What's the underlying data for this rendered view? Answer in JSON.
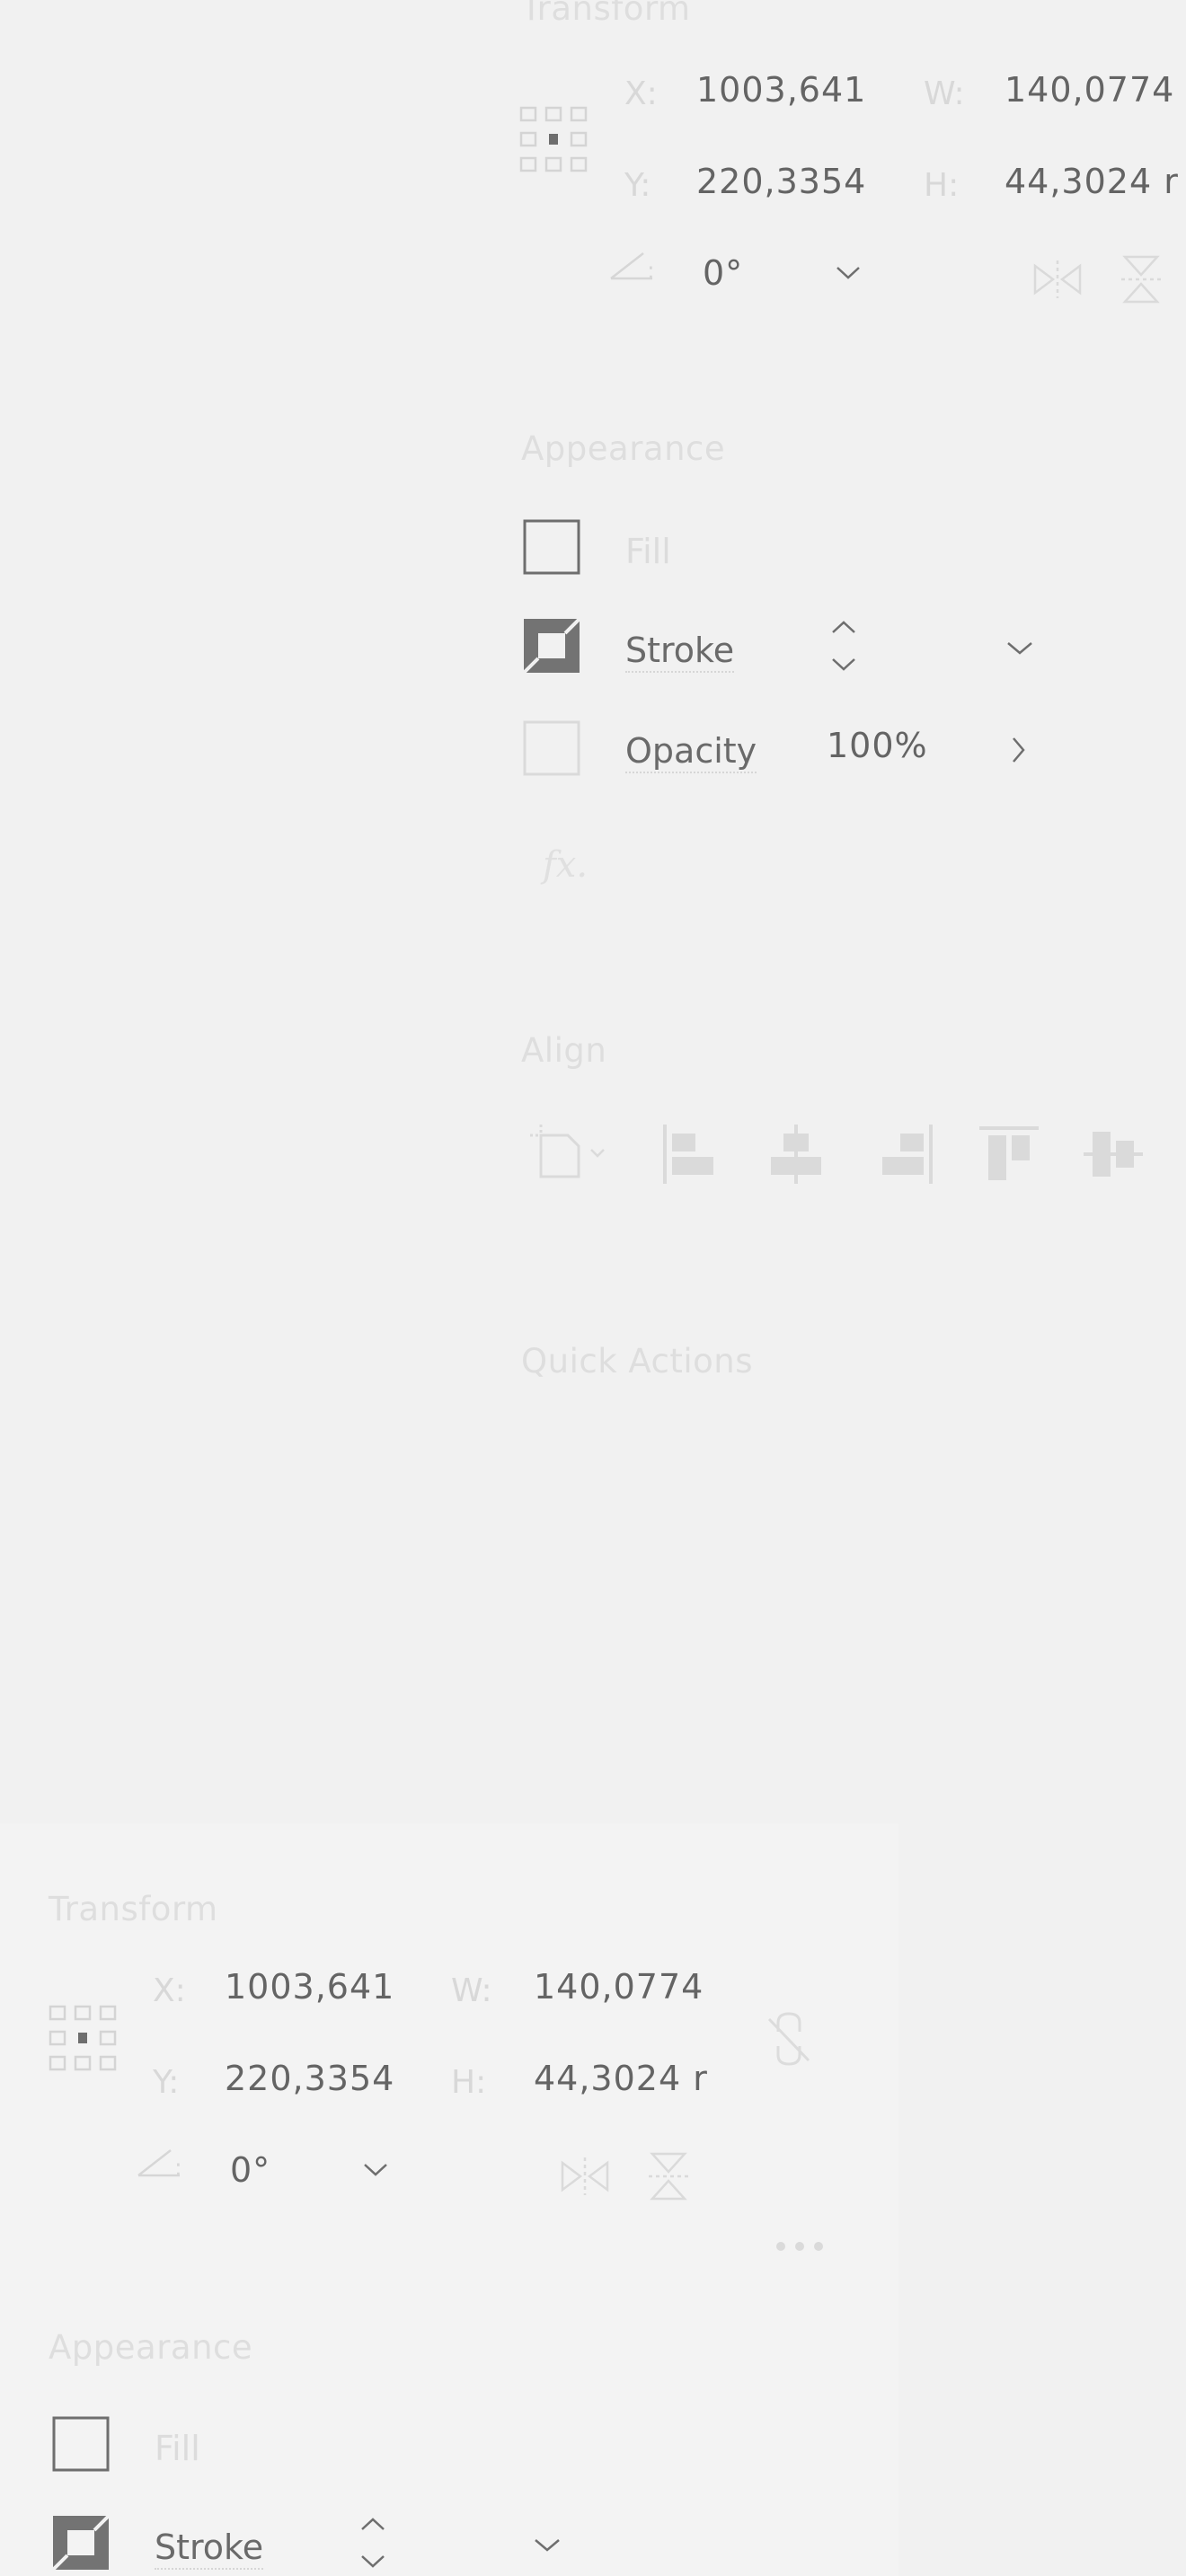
{
  "top_panel": {
    "transform": {
      "title": "Transform",
      "x_label": "X:",
      "x_value": "1003,641",
      "y_label": "Y:",
      "y_value": "220,3354",
      "w_label": "W:",
      "w_value": "140,0774",
      "h_label": "H:",
      "h_value": "44,3024 r",
      "rotation_value": "0°"
    },
    "appearance": {
      "title": "Appearance",
      "fill_label": "Fill",
      "stroke_label": "Stroke",
      "opacity_label": "Opacity",
      "opacity_value": "100%",
      "fx_label": "fx."
    },
    "align": {
      "title": "Align"
    },
    "quick_actions": {
      "title": "Quick Actions"
    }
  },
  "bottom_panel": {
    "transform": {
      "title": "Transform",
      "x_label": "X:",
      "x_value": "1003,641",
      "y_label": "Y:",
      "y_value": "220,3354",
      "w_label": "W:",
      "w_value": "140,0774",
      "h_label": "H:",
      "h_value": "44,3024 r",
      "rotation_value": "0°"
    },
    "appearance": {
      "title": "Appearance",
      "fill_label": "Fill",
      "stroke_label": "Stroke"
    }
  },
  "colors": {
    "background": "#f1f1f1",
    "text_value": "#646464",
    "text_faint": "#dcdcdc",
    "icon_dark": "#6e6e6e",
    "icon_faint": "#dadada"
  },
  "icons": {
    "reference_point": "reference-point-grid-icon",
    "rotation": "angle-icon",
    "dropdown": "chevron-down-icon",
    "flip_horizontal": "flip-horizontal-icon",
    "flip_vertical": "flip-vertical-icon",
    "fill_swatch": "fill-swatch-icon",
    "stroke_swatch": "stroke-swatch-icon",
    "stepper": "stepper-icon",
    "expand": "chevron-right-icon",
    "align_to": "align-to-selection-icon",
    "align_left": "align-left-icon",
    "align_hcenter": "align-horizontal-center-icon",
    "align_right": "align-right-icon",
    "align_top": "align-top-icon",
    "align_vcenter": "align-vertical-center-icon",
    "constrain": "link-broken-icon",
    "more": "more-options-icon"
  }
}
